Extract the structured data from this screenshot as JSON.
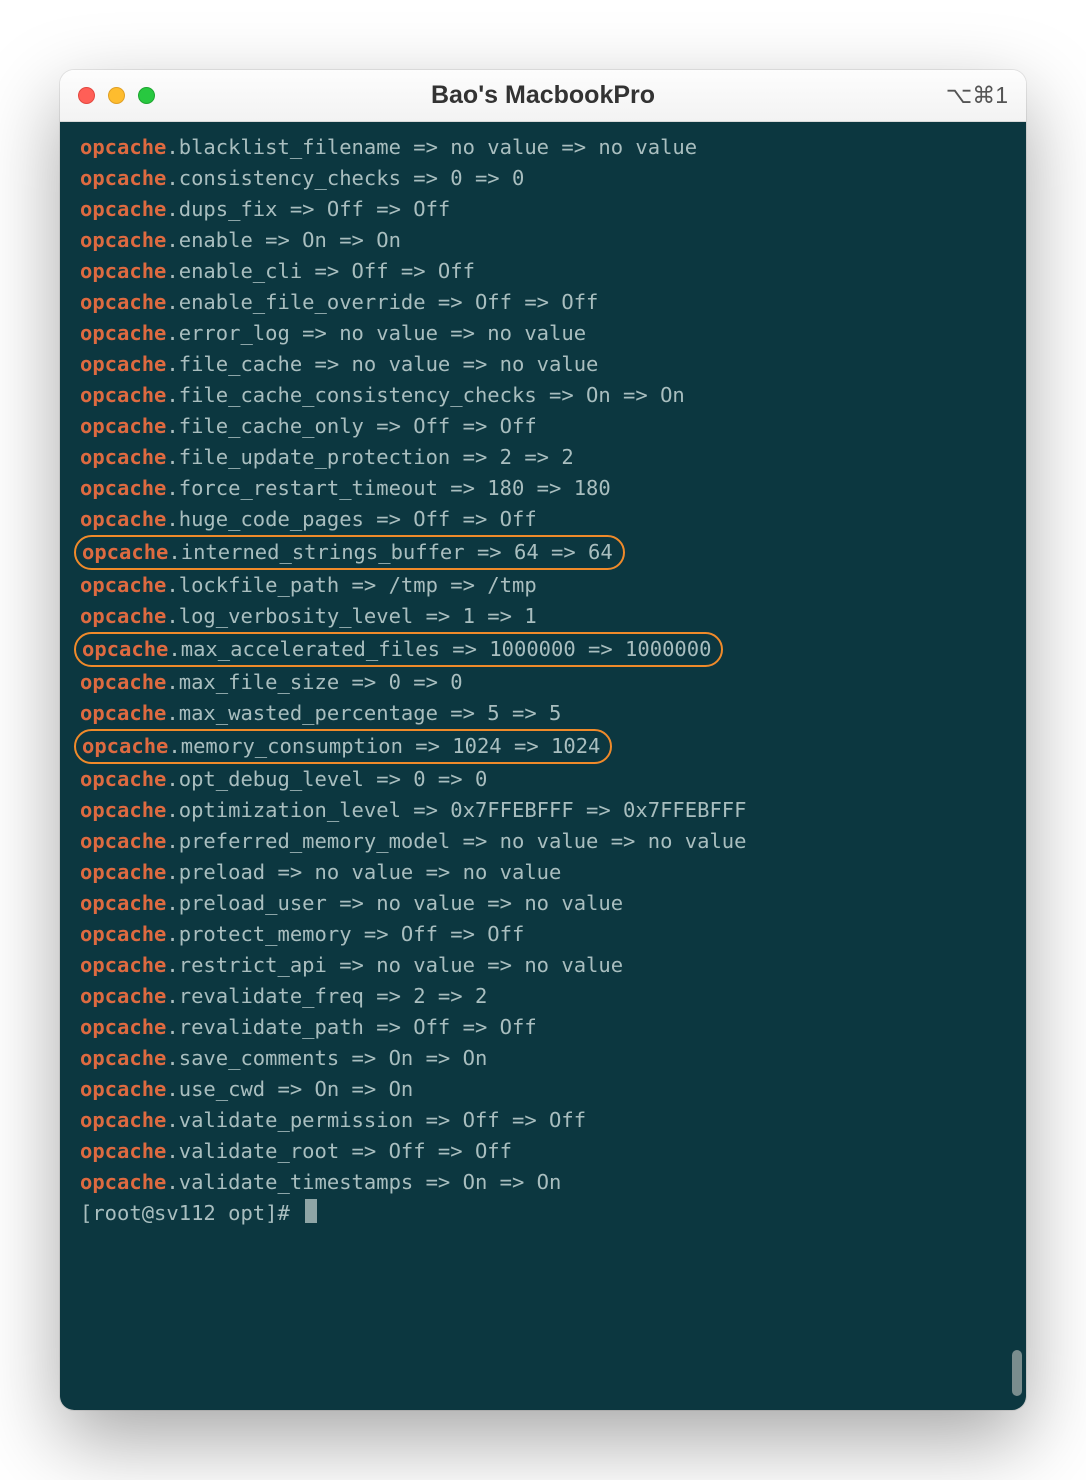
{
  "window": {
    "title": "Bao's MacbookPro",
    "shortcut": "⌥⌘1"
  },
  "colors": {
    "terminal_bg": "#0c3740",
    "keyword": "#de6a40",
    "text": "#a9bebf",
    "highlight_border": "#f08a2a"
  },
  "config_prefix": "opcache",
  "lines": [
    {
      "setting": "blacklist_filename",
      "local": "no value",
      "master": "no value",
      "highlighted": false
    },
    {
      "setting": "consistency_checks",
      "local": "0",
      "master": "0",
      "highlighted": false
    },
    {
      "setting": "dups_fix",
      "local": "Off",
      "master": "Off",
      "highlighted": false
    },
    {
      "setting": "enable",
      "local": "On",
      "master": "On",
      "highlighted": false
    },
    {
      "setting": "enable_cli",
      "local": "Off",
      "master": "Off",
      "highlighted": false
    },
    {
      "setting": "enable_file_override",
      "local": "Off",
      "master": "Off",
      "highlighted": false
    },
    {
      "setting": "error_log",
      "local": "no value",
      "master": "no value",
      "highlighted": false
    },
    {
      "setting": "file_cache",
      "local": "no value",
      "master": "no value",
      "highlighted": false
    },
    {
      "setting": "file_cache_consistency_checks",
      "local": "On",
      "master": "On",
      "highlighted": false
    },
    {
      "setting": "file_cache_only",
      "local": "Off",
      "master": "Off",
      "highlighted": false
    },
    {
      "setting": "file_update_protection",
      "local": "2",
      "master": "2",
      "highlighted": false
    },
    {
      "setting": "force_restart_timeout",
      "local": "180",
      "master": "180",
      "highlighted": false
    },
    {
      "setting": "huge_code_pages",
      "local": "Off",
      "master": "Off",
      "highlighted": false
    },
    {
      "setting": "interned_strings_buffer",
      "local": "64",
      "master": "64",
      "highlighted": true
    },
    {
      "setting": "lockfile_path",
      "local": "/tmp",
      "master": "/tmp",
      "highlighted": false
    },
    {
      "setting": "log_verbosity_level",
      "local": "1",
      "master": "1",
      "highlighted": false
    },
    {
      "setting": "max_accelerated_files",
      "local": "1000000",
      "master": "1000000",
      "highlighted": true
    },
    {
      "setting": "max_file_size",
      "local": "0",
      "master": "0",
      "highlighted": false
    },
    {
      "setting": "max_wasted_percentage",
      "local": "5",
      "master": "5",
      "highlighted": false
    },
    {
      "setting": "memory_consumption",
      "local": "1024",
      "master": "1024",
      "highlighted": true
    },
    {
      "setting": "opt_debug_level",
      "local": "0",
      "master": "0",
      "highlighted": false
    },
    {
      "setting": "optimization_level",
      "local": "0x7FFEBFFF",
      "master": "0x7FFEBFFF",
      "highlighted": false
    },
    {
      "setting": "preferred_memory_model",
      "local": "no value",
      "master": "no value",
      "highlighted": false
    },
    {
      "setting": "preload",
      "local": "no value",
      "master": "no value",
      "highlighted": false
    },
    {
      "setting": "preload_user",
      "local": "no value",
      "master": "no value",
      "highlighted": false
    },
    {
      "setting": "protect_memory",
      "local": "Off",
      "master": "Off",
      "highlighted": false
    },
    {
      "setting": "restrict_api",
      "local": "no value",
      "master": "no value",
      "highlighted": false
    },
    {
      "setting": "revalidate_freq",
      "local": "2",
      "master": "2",
      "highlighted": false
    },
    {
      "setting": "revalidate_path",
      "local": "Off",
      "master": "Off",
      "highlighted": false
    },
    {
      "setting": "save_comments",
      "local": "On",
      "master": "On",
      "highlighted": false
    },
    {
      "setting": "use_cwd",
      "local": "On",
      "master": "On",
      "highlighted": false
    },
    {
      "setting": "validate_permission",
      "local": "Off",
      "master": "Off",
      "highlighted": false
    },
    {
      "setting": "validate_root",
      "local": "Off",
      "master": "Off",
      "highlighted": false
    },
    {
      "setting": "validate_timestamps",
      "local": "On",
      "master": "On",
      "highlighted": false
    }
  ],
  "prompt": {
    "user": "root",
    "host": "sv112",
    "cwd": "opt",
    "symbol": "#"
  }
}
